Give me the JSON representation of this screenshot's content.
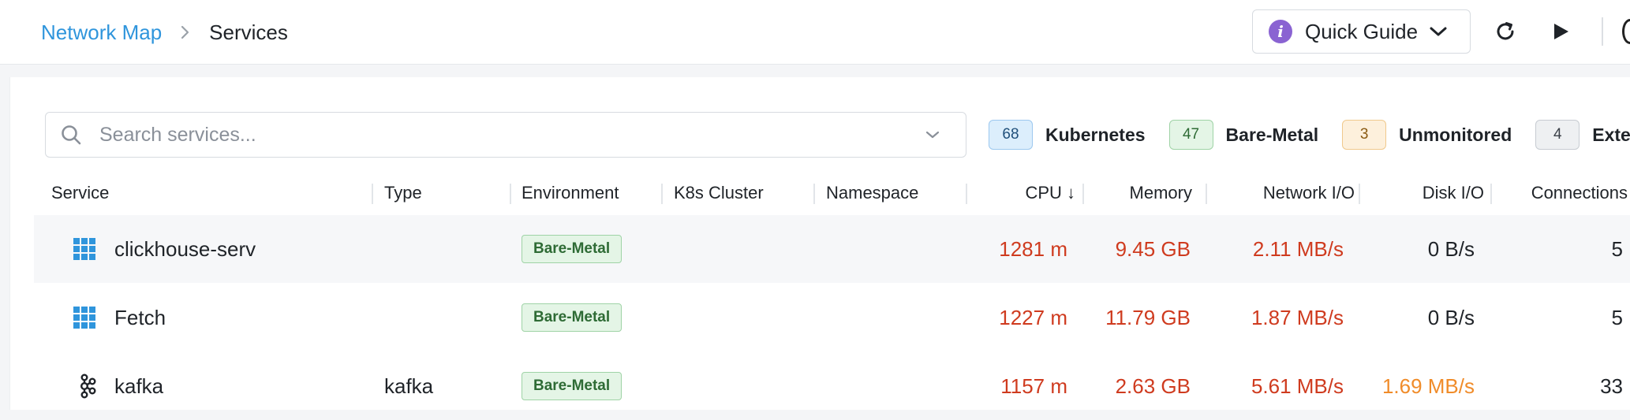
{
  "breadcrumb": {
    "parent": "Network Map",
    "current": "Services"
  },
  "header": {
    "quick_guide_label": "Quick Guide"
  },
  "search": {
    "placeholder": "Search services..."
  },
  "chips": [
    {
      "count": "68",
      "label": "Kubernetes",
      "bg": "#dceefc",
      "border": "#9cc8ef",
      "color": "#1f4f7a"
    },
    {
      "count": "47",
      "label": "Bare-Metal",
      "bg": "#e4f5e6",
      "border": "#9fd3a6",
      "color": "#2e6b35"
    },
    {
      "count": "3",
      "label": "Unmonitored",
      "bg": "#fdf0dc",
      "border": "#f0c98d",
      "color": "#8a5a12"
    },
    {
      "count": "4",
      "label": "External",
      "bg": "#eef0f2",
      "border": "#c7ccd2",
      "color": "#3b4149"
    }
  ],
  "table": {
    "columns": {
      "service": "Service",
      "type": "Type",
      "environment": "Environment",
      "k8s_cluster": "K8s Cluster",
      "namespace": "Namespace",
      "cpu": "CPU ↓",
      "memory": "Memory",
      "network_io": "Network I/O",
      "disk_io": "Disk I/O",
      "connections": "Connections"
    },
    "rows": [
      {
        "icon": "grid-icon",
        "service": "clickhouse-serv",
        "type": "",
        "environment": "Bare-Metal",
        "k8s_cluster": "",
        "namespace": "",
        "cpu": "1281 m",
        "memory": "9.45 GB",
        "network_io": "2.11 MB/s",
        "disk_io": "0 B/s",
        "connections": "5"
      },
      {
        "icon": "grid-icon",
        "service": "Fetch",
        "type": "",
        "environment": "Bare-Metal",
        "k8s_cluster": "",
        "namespace": "",
        "cpu": "1227 m",
        "memory": "11.79 GB",
        "network_io": "1.87 MB/s",
        "disk_io": "0 B/s",
        "connections": "5"
      },
      {
        "icon": "kafka-icon",
        "service": "kafka",
        "type": "kafka",
        "environment": "Bare-Metal",
        "k8s_cluster": "",
        "namespace": "",
        "cpu": "1157 m",
        "memory": "2.63 GB",
        "network_io": "5.61 MB/s",
        "disk_io": "1.69 MB/s",
        "connections": "33"
      }
    ]
  },
  "colors": {
    "link": "#2f95dc",
    "metric_high": "#cf3b1f",
    "metric_warn": "#f08c2a"
  }
}
